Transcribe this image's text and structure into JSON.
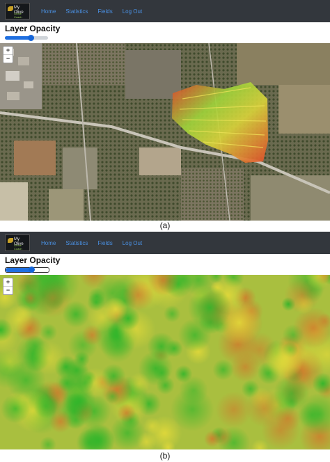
{
  "panels": [
    {
      "nav": {
        "logo_text": "My Olive",
        "logo_sub": "Grove Coach",
        "links": [
          "Home",
          "Statistics",
          "Fields",
          "Log Out"
        ]
      },
      "layer_opacity": {
        "title": "Layer Opacity",
        "value": 0.6
      },
      "zoom": {
        "in": "+",
        "out": "−"
      },
      "map_layer": "satellite imagery with field overlay",
      "caption": "(a)"
    },
    {
      "nav": {
        "logo_text": "My Olive",
        "logo_sub": "Grove Coach",
        "links": [
          "Home",
          "Statistics",
          "Fields",
          "Log Out"
        ]
      },
      "layer_opacity": {
        "title": "Layer Opacity",
        "value": 0.6
      },
      "zoom": {
        "in": "+",
        "out": "−"
      },
      "map_layer": "zoomed vegetation index heatmap",
      "caption": "(b)"
    }
  ],
  "colors": {
    "navbar": "#33373d",
    "link": "#4a90e2",
    "slider": "#1f6fe0",
    "heat_high": "#3fbf2a",
    "heat_mid": "#d9d23a",
    "heat_low": "#d9452a"
  }
}
